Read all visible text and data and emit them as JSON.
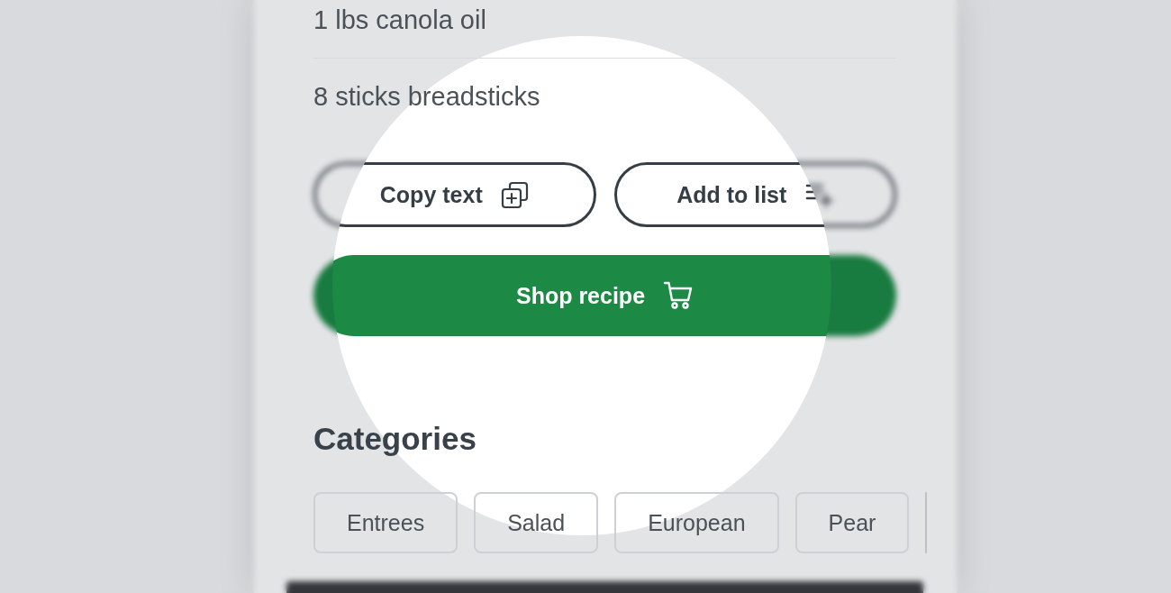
{
  "ingredients": [
    "1 lbs canola oil",
    "8 sticks breadsticks"
  ],
  "actions": [
    {
      "label": "Copy text"
    },
    {
      "label": "Add to list"
    }
  ],
  "primary_button": {
    "label": "Shop recipe"
  },
  "categories": {
    "title": "Categories",
    "items": [
      "Entrees",
      "Salad",
      "European",
      "Pear"
    ]
  }
}
